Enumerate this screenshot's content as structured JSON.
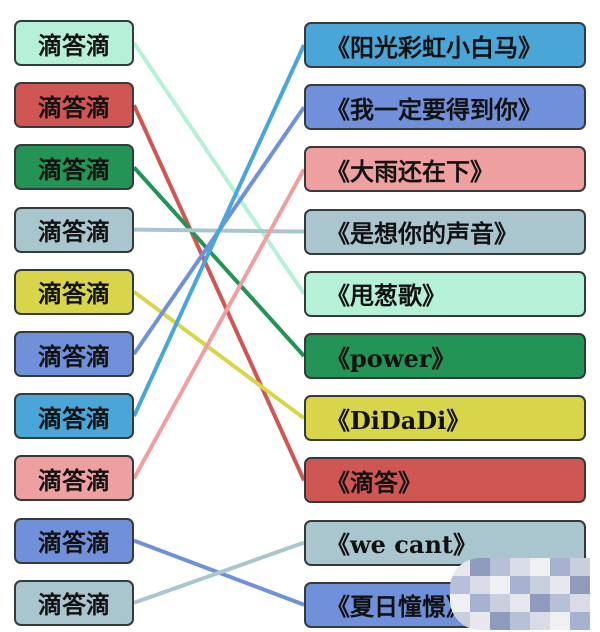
{
  "left_items": [
    {
      "label": "滴答滴",
      "color": "#b4f1d6",
      "target": 4
    },
    {
      "label": "滴答滴",
      "color": "#d05653",
      "target": 7
    },
    {
      "label": "滴答滴",
      "color": "#239356",
      "target": 5
    },
    {
      "label": "滴答滴",
      "color": "#a9c6cf",
      "target": 3
    },
    {
      "label": "滴答滴",
      "color": "#d8d54b",
      "target": 6
    },
    {
      "label": "滴答滴",
      "color": "#7090d9",
      "target": 1
    },
    {
      "label": "滴答滴",
      "color": "#4ba6d8",
      "target": 0
    },
    {
      "label": "滴答滴",
      "color": "#ee9f9f",
      "target": 2
    },
    {
      "label": "滴答滴",
      "color": "#7090d9",
      "target": 9
    },
    {
      "label": "滴答滴",
      "color": "#a9c6cf",
      "target": 8
    }
  ],
  "right_items": [
    {
      "label": "《阳光彩虹小白马》",
      "color": "#4ba6d8"
    },
    {
      "label": "《我一定要得到你》",
      "color": "#7090d9"
    },
    {
      "label": "《大雨还在下》",
      "color": "#ee9f9f"
    },
    {
      "label": "《是想你的声音》",
      "color": "#a9c6cf"
    },
    {
      "label": "《甩葱歌》",
      "color": "#b4f1d6"
    },
    {
      "label": "《power》",
      "color": "#239356"
    },
    {
      "label": "《DiDaDi》",
      "color": "#d8d54b"
    },
    {
      "label": "《滴答》",
      "color": "#d05653"
    },
    {
      "label": "《we cant》",
      "color": "#a9c6cf"
    },
    {
      "label": "《夏日憧憬》",
      "color": "#7090d9"
    }
  ]
}
